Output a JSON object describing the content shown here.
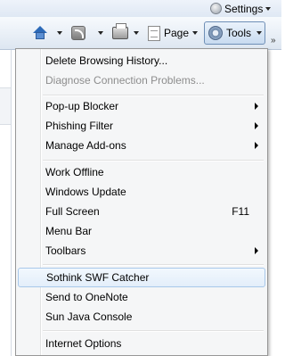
{
  "toolbar": {
    "settings_label": "Settings",
    "page_label": "Page",
    "tools_label": "Tools",
    "overflow_label": "»"
  },
  "icons": {
    "home": "home-icon",
    "feeds": "feeds-icon",
    "print": "printer-icon",
    "page": "page-icon",
    "tools": "gear-icon",
    "settings": "settings-circle-icon"
  },
  "menu": {
    "items": [
      {
        "label": "Delete Browsing History...",
        "enabled": true
      },
      {
        "label": "Diagnose Connection Problems...",
        "enabled": false
      },
      {
        "label": "Pop-up Blocker",
        "submenu": true
      },
      {
        "label": "Phishing Filter",
        "submenu": true
      },
      {
        "label": "Manage Add-ons",
        "submenu": true
      },
      {
        "label": "Work Offline"
      },
      {
        "label": "Windows Update"
      },
      {
        "label": "Full Screen",
        "accelerator": "F11"
      },
      {
        "label": "Menu Bar"
      },
      {
        "label": "Toolbars",
        "submenu": true
      },
      {
        "label": "Sothink SWF Catcher",
        "highlighted": true
      },
      {
        "label": "Send to OneNote"
      },
      {
        "label": "Sun Java Console"
      },
      {
        "label": "Internet Options"
      }
    ]
  },
  "colors": {
    "menu_bg": "#f5f6f7",
    "highlight_border": "#a8c8ea",
    "disabled_text": "#8d8d8d"
  }
}
